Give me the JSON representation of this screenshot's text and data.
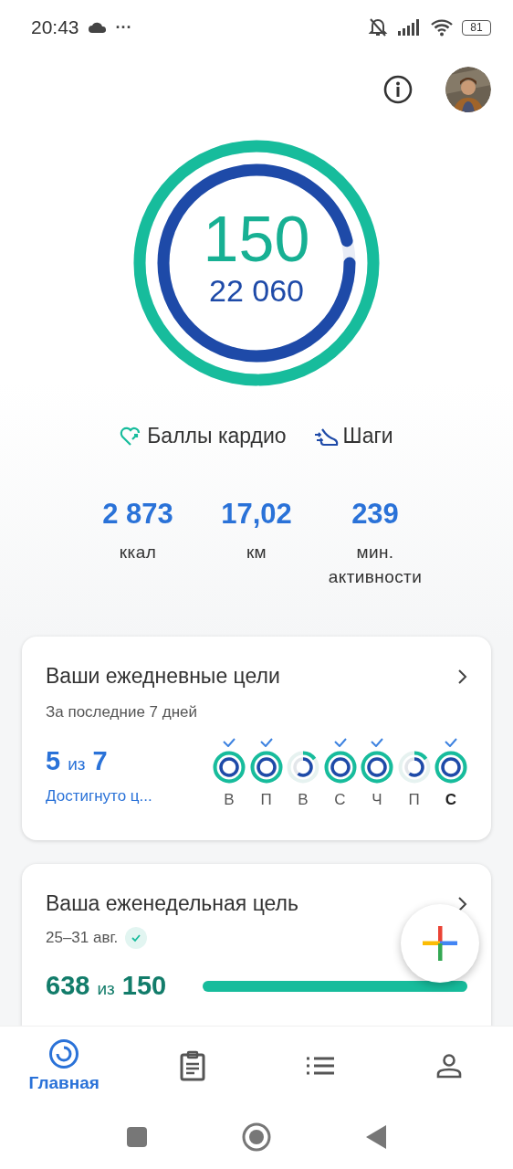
{
  "status_bar": {
    "time": "20:43",
    "more": "···",
    "battery": "81"
  },
  "rings": {
    "cardio": {
      "value": "150"
    },
    "steps": {
      "value": "22 060"
    }
  },
  "legend": [
    {
      "kind": "cardio",
      "label": "Баллы кардио"
    },
    {
      "kind": "steps",
      "label": "Шаги"
    }
  ],
  "stats": [
    {
      "value": "2 873",
      "label": "ккал"
    },
    {
      "value": "17,02",
      "label": "км"
    },
    {
      "value": "239",
      "label": "мин. активности"
    }
  ],
  "daily_card": {
    "title": "Ваши ежедневные цели",
    "subtitle": "За последние 7 дней",
    "count": "5",
    "of": "из",
    "total": "7",
    "link": "Достигнуто ц...",
    "days": [
      {
        "label": "В",
        "checked": true,
        "selected": false
      },
      {
        "label": "П",
        "checked": true,
        "selected": false
      },
      {
        "label": "В",
        "checked": false,
        "selected": false
      },
      {
        "label": "С",
        "checked": true,
        "selected": false
      },
      {
        "label": "Ч",
        "checked": true,
        "selected": false
      },
      {
        "label": "П",
        "checked": false,
        "selected": false
      },
      {
        "label": "С",
        "checked": true,
        "selected": true
      }
    ]
  },
  "weekly_card": {
    "title": "Ваша еженедельная цель",
    "dates": "25–31 авг.",
    "met": true,
    "value": "638",
    "of": "из",
    "goal": "150",
    "level": 1
  },
  "nav": [
    {
      "kind": "home",
      "label": "Главная",
      "selected": true
    },
    {
      "kind": "journal",
      "selected": false
    },
    {
      "kind": "browse",
      "selected": false
    },
    {
      "kind": "profile",
      "selected": false
    }
  ]
}
